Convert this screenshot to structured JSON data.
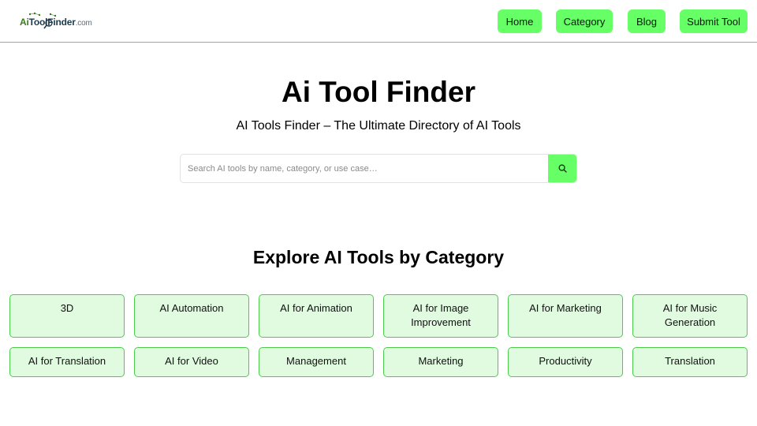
{
  "logo": {
    "part1": "Ai",
    "part2": "Tool",
    "part3": "Finder",
    "suffix": ".com"
  },
  "nav": {
    "items": [
      {
        "label": "Home"
      },
      {
        "label": "Category"
      },
      {
        "label": "Blog"
      },
      {
        "label": "Submit Tool"
      }
    ]
  },
  "hero": {
    "title": "Ai Tool Finder",
    "subtitle": "AI Tools Finder – The Ultimate Directory of AI Tools"
  },
  "search": {
    "placeholder": "Search AI tools by name, category, or use case…",
    "value": "",
    "button_icon": "search-icon"
  },
  "categories": {
    "title": "Explore AI Tools by Category",
    "items": [
      {
        "label": "3D"
      },
      {
        "label": "AI Automation"
      },
      {
        "label": "AI for Animation"
      },
      {
        "label": "AI for Image Improvement"
      },
      {
        "label": "AI for Marketing"
      },
      {
        "label": "AI for Music Generation"
      },
      {
        "label": "AI for Translation"
      },
      {
        "label": "AI for Video"
      },
      {
        "label": "Management"
      },
      {
        "label": "Marketing"
      },
      {
        "label": "Productivity"
      },
      {
        "label": "Translation"
      }
    ]
  },
  "colors": {
    "accent": "#66ff66",
    "card_bg": "#e0fbe0",
    "card_border": "#4ccc4c",
    "header_border": "#5fd35f"
  }
}
